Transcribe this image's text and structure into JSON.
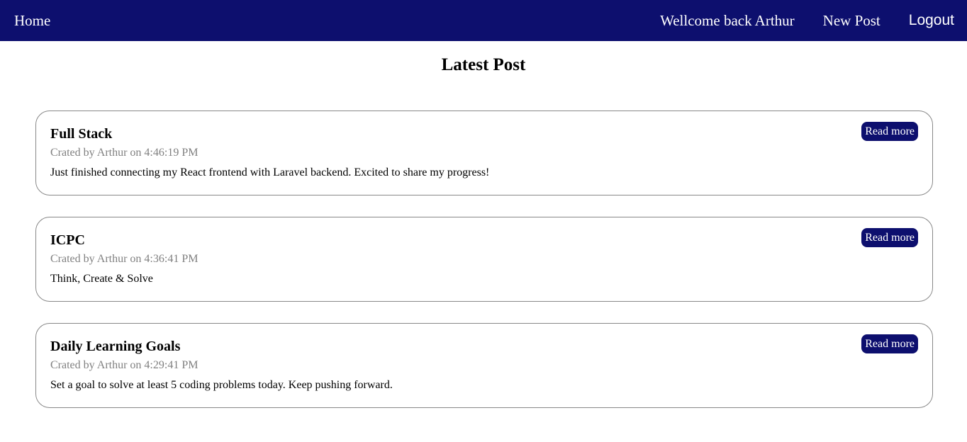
{
  "nav": {
    "home": "Home",
    "welcome": "Wellcome back Arthur",
    "new_post": "New Post",
    "logout": "Logout"
  },
  "page": {
    "title": "Latest Post"
  },
  "posts": [
    {
      "title": "Full Stack",
      "meta": "Crated by Arthur on 4:46:19 PM",
      "body": "Just finished connecting my React frontend with Laravel backend. Excited to share my progress!",
      "read_more": "Read more"
    },
    {
      "title": "ICPC",
      "meta": "Crated by Arthur on 4:36:41 PM",
      "body": "Think, Create & Solve",
      "read_more": "Read more"
    },
    {
      "title": "Daily Learning Goals",
      "meta": "Crated by Arthur on 4:29:41 PM",
      "body": "Set a goal to solve at least 5 coding problems today. Keep pushing forward.",
      "read_more": "Read more"
    }
  ],
  "colors": {
    "nav_bg": "#0d0f6e",
    "meta_text": "#808080",
    "card_border": "#888888"
  }
}
